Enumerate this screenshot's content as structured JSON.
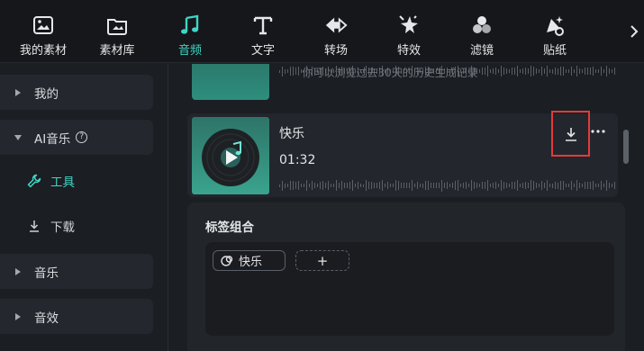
{
  "toolbar": {
    "items": [
      {
        "label": "我的素材",
        "icon": "media-icon",
        "active": false
      },
      {
        "label": "素材库",
        "icon": "library-icon",
        "active": false
      },
      {
        "label": "音频",
        "icon": "music-note-icon",
        "active": true
      },
      {
        "label": "文字",
        "icon": "text-icon",
        "active": false
      },
      {
        "label": "转场",
        "icon": "transition-icon",
        "active": false
      },
      {
        "label": "特效",
        "icon": "effects-icon",
        "active": false
      },
      {
        "label": "滤镜",
        "icon": "filter-icon",
        "active": false
      },
      {
        "label": "贴纸",
        "icon": "sticker-icon",
        "active": false
      }
    ],
    "accent": "#3fd6c4"
  },
  "sidebar": {
    "mine": "我的",
    "ai_music": "AI音乐",
    "ai_help": "?",
    "tools": "工具",
    "downloads": "下载",
    "music": "音乐",
    "sfx": "音效"
  },
  "main": {
    "history_note": "你可以浏览过去30天的历史生成记录",
    "track": {
      "title": "快乐",
      "duration": "01:32"
    },
    "tags": {
      "title": "标签组合",
      "chips": [
        "快乐"
      ],
      "add_label": "+"
    }
  },
  "highlight_color": "#e23b3b"
}
